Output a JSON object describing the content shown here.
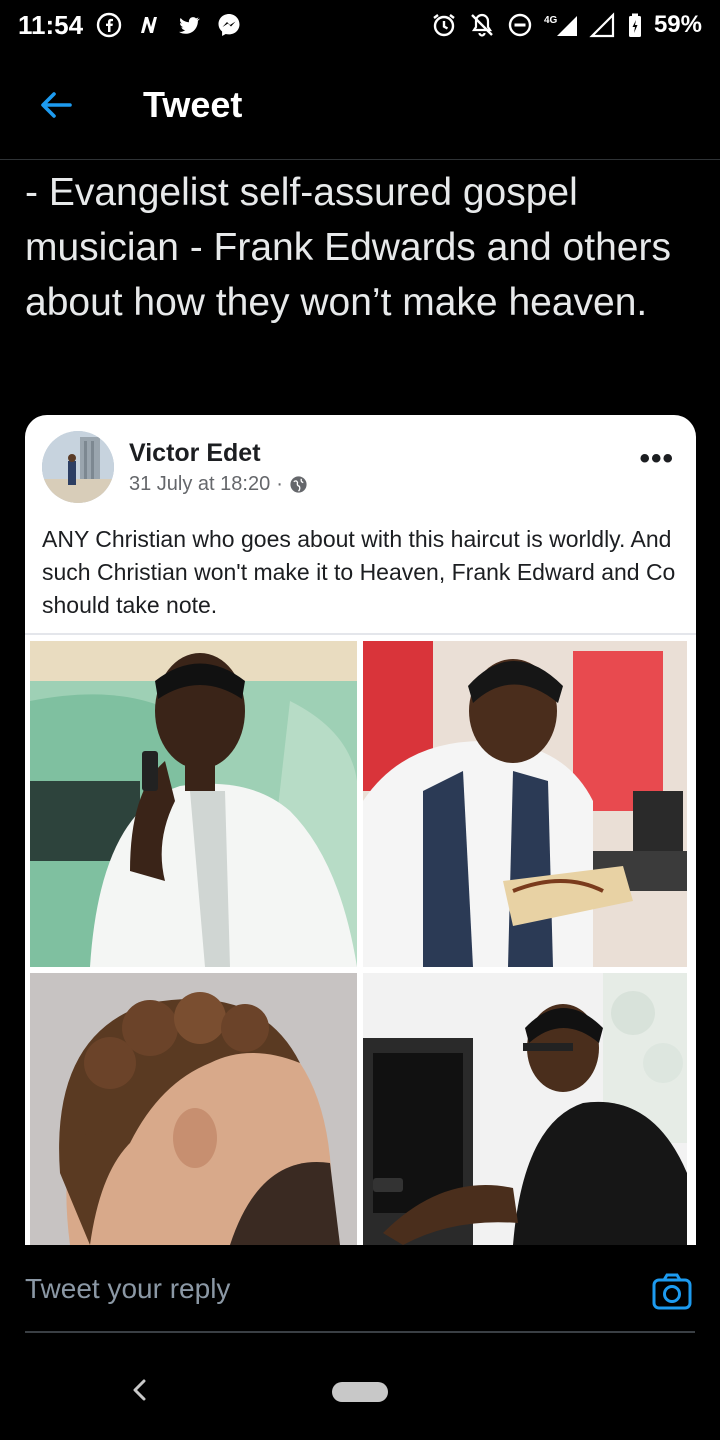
{
  "status_bar": {
    "time": "11:54",
    "left_icons": [
      "facebook-icon",
      "news-icon",
      "twitter-icon",
      "messenger-icon"
    ],
    "right_icons": [
      "alarm-icon",
      "mute-icon",
      "dnd-icon",
      "signal-4g-icon",
      "signal-icon",
      "battery-icon"
    ],
    "network": "4G",
    "battery": "59%"
  },
  "header": {
    "back_icon": "arrow-left-icon",
    "title": "Tweet",
    "accent": "#1d9bf0"
  },
  "tweet": {
    "text": "- Evangelist self-assured gospel musician - Frank Edwards and others about how they won’t make heaven."
  },
  "embedded_post": {
    "author": "Victor Edet",
    "timestamp": "31 July at 18:20",
    "separator": "·",
    "privacy_icon": "globe-icon",
    "more_icon": "more-horizontal-icon",
    "more_label": "•••",
    "body": "ANY Christian who goes about with this haircut is worldly. And such Christian won't make it to Heaven, Frank Edward and Co should take note.",
    "photos": [
      "photo-man-phone",
      "photo-man-bible",
      "photo-curly-haircut",
      "photo-man-piano"
    ]
  },
  "reply": {
    "placeholder": "Tweet your reply",
    "camera_icon": "camera-icon"
  },
  "nav": {
    "back_icon": "nav-back-icon",
    "home_icon": "nav-home-pill"
  }
}
